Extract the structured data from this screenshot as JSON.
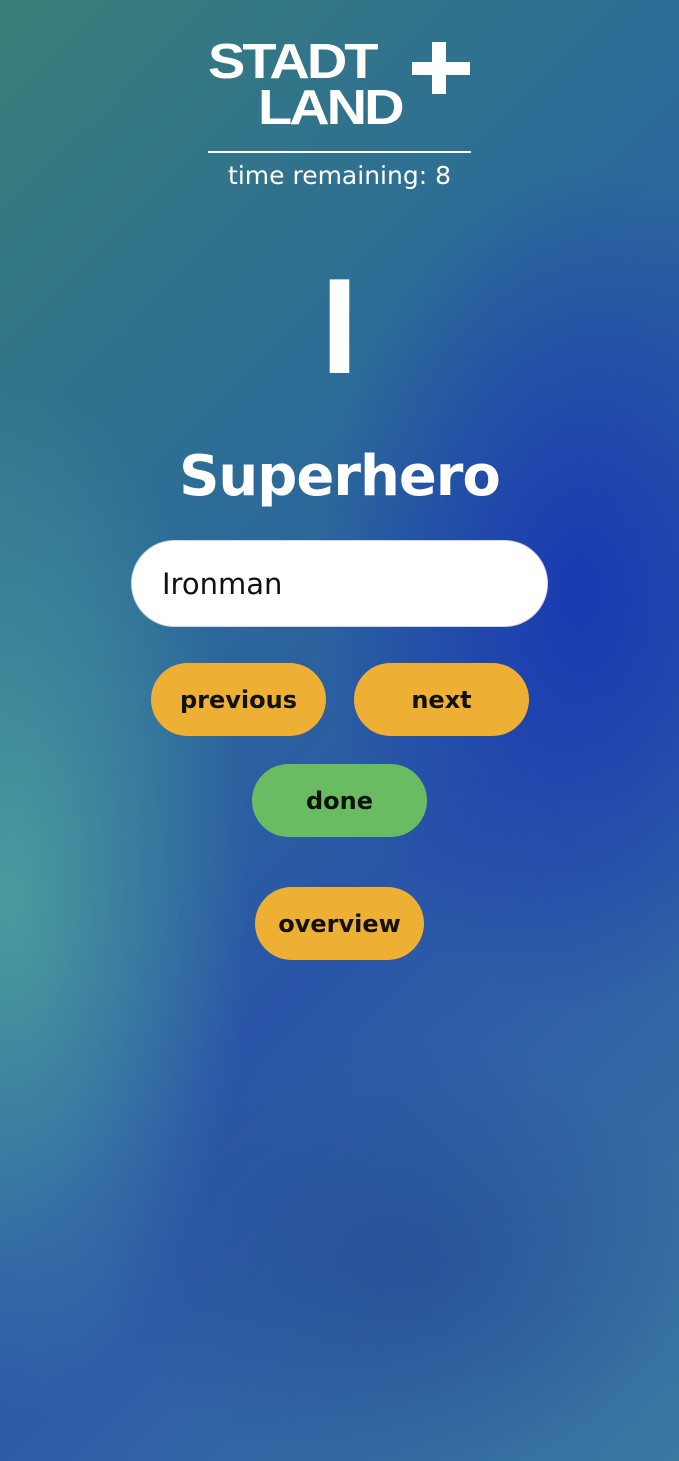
{
  "app": {
    "logo": {
      "line1": "STADT",
      "line2": "LAND",
      "plus": "+"
    },
    "timer_text": "time remaining: 8"
  },
  "round": {
    "letter": "I",
    "category": "Superhero"
  },
  "answer_input": {
    "value": "Ironman",
    "placeholder": ""
  },
  "buttons": {
    "previous": "previous",
    "next": "next",
    "done": "done",
    "overview": "overview"
  },
  "colors": {
    "primary_button": "#eeb034",
    "done_button": "#69bc62",
    "text_light": "#ffffff",
    "text_dark": "#111111"
  }
}
